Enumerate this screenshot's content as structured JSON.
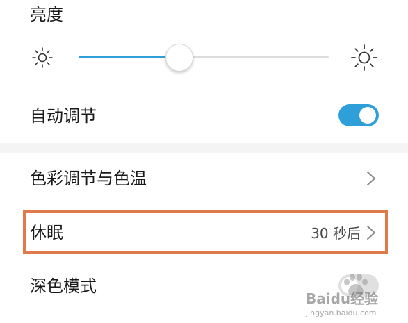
{
  "brightness": {
    "title": "亮度",
    "level": 0.4,
    "fill_color": "#2f9fd9",
    "min_icon": "sun-small-icon",
    "max_icon": "sun-large-icon"
  },
  "auto_adjust": {
    "label": "自动调节",
    "enabled": true,
    "accent": "#2f9fd9"
  },
  "rows": {
    "color_temp": {
      "label": "色彩调节与色温",
      "icon": "chevron-right-icon"
    },
    "sleep": {
      "label": "休眠",
      "value": "30 秒后",
      "icon": "chevron-right-icon",
      "highlight_color": "#e07a4a"
    },
    "dark_mode": {
      "label": "深色模式",
      "enabled": false
    }
  },
  "watermark": {
    "brand": "Baidu经验",
    "url": "jingyan.baidu.com"
  }
}
